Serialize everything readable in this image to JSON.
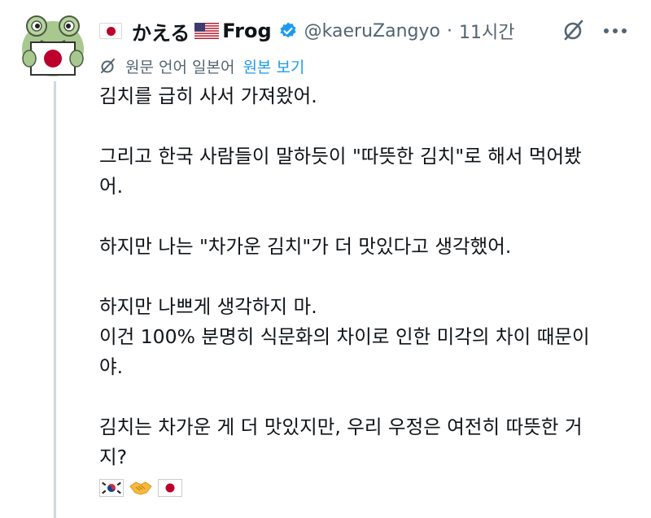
{
  "author": {
    "display_name_prefix_flag": "jp-flag",
    "display_name": "かえる",
    "display_name_middle_flag": "us-flag",
    "display_name_suffix": "Frog",
    "verified": true,
    "handle": "@kaeruZangyo",
    "separator": "·",
    "time": "11시간"
  },
  "translation": {
    "icon": "grok-icon",
    "notice": "원문 언어 일본어",
    "show_original": "원본 보기"
  },
  "actions": {
    "grok_icon": "grok-icon",
    "more_icon": "more-icon"
  },
  "tweet_lines": [
    "김치를 급히 사서 가져왔어.",
    "",
    "그리고 한국 사람들이 말하듯이 \"따뜻한 김치\"로 해서 먹어봤",
    "어.",
    "",
    "하지만 나는 \"차가운 김치\"가 더 맛있다고 생각했어.",
    "",
    "하지만 나쁘게 생각하지 마.",
    "이건 100% 분명히 식문화의 차이로 인한 미각의 차이 때문이",
    "야.",
    "",
    "김치는 차가운 게 더 맛있지만, 우리 우정은 여전히 따뜻한 거",
    "지?"
  ],
  "emojis": [
    "kr-flag",
    "handshake",
    "jp-flag"
  ],
  "colors": {
    "text": "#0f1419",
    "secondary": "#536471",
    "link": "#1d9bf0",
    "verified": "#1d9bf0",
    "thread_line": "#cfd9de",
    "japan_red": "#bc002d"
  }
}
